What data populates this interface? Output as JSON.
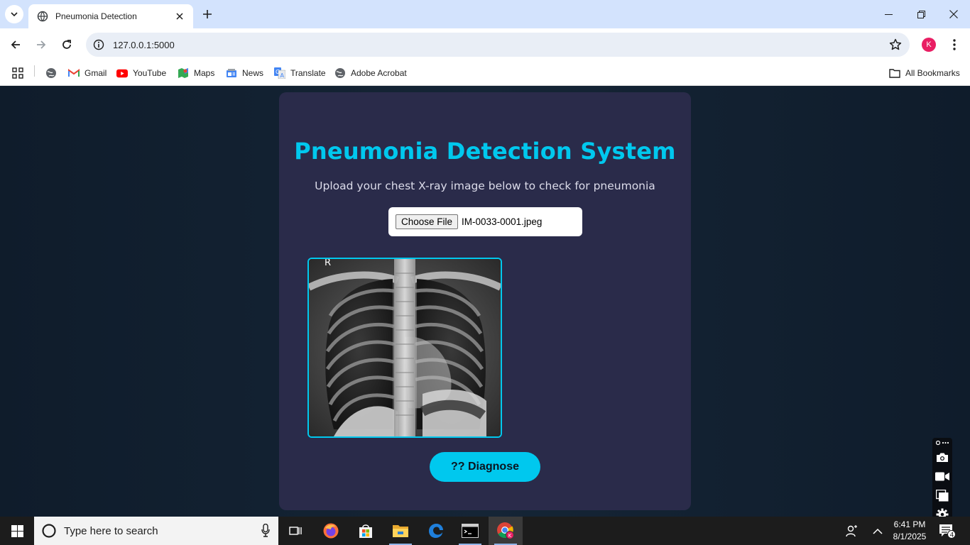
{
  "browser": {
    "tab": {
      "title": "Pneumonia Detection"
    },
    "address": {
      "url": "127.0.0.1:5000"
    },
    "profile_initial": "K",
    "bookmarks": [
      {
        "label": "Gmail",
        "icon": "gmail-icon"
      },
      {
        "label": "YouTube",
        "icon": "youtube-icon"
      },
      {
        "label": "Maps",
        "icon": "maps-icon"
      },
      {
        "label": "News",
        "icon": "news-icon"
      },
      {
        "label": "Translate",
        "icon": "translate-icon"
      },
      {
        "label": "Adobe Acrobat",
        "icon": "globe-icon"
      }
    ],
    "all_bookmarks": "All Bookmarks"
  },
  "app": {
    "heading": "Pneumonia Detection System",
    "subheading": "Upload your chest X-ray image below to check for pneumonia",
    "file_button": "Choose File",
    "file_name": "IM-0033-0001.jpeg",
    "xray_marker": "R",
    "diagnose_label": "?? Diagnose"
  },
  "taskbar": {
    "search_placeholder": "Type here to search",
    "time": "6:41 PM",
    "date": "8/1/2025",
    "notification_count": "4",
    "chrome_badge": "K"
  },
  "colors": {
    "accent": "#00c8ee",
    "card": "#2a2b4a",
    "page_bg": "#0f1c2b",
    "tabbar": "#d3e3fd"
  }
}
